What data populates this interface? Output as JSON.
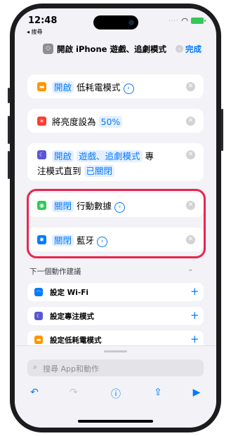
{
  "status": {
    "time": "12:48",
    "back_app": "◂ 搜尋"
  },
  "nav": {
    "title": "開啟 iPhone 遊戲、追劇模式",
    "done": "完成"
  },
  "actions": [
    {
      "verb": "開啟",
      "label": "低耗電模式"
    },
    {
      "text": "將亮度設為",
      "value": "50%"
    },
    {
      "verb": "開啟",
      "mode": "遊戲、追劇模式",
      "text1": "專",
      "text2": "注模式直到",
      "until": "已關閉"
    },
    {
      "verb": "關閉",
      "label": "行動數據"
    },
    {
      "verb": "關閉",
      "label": "藍牙"
    }
  ],
  "suggestions": {
    "header": "下一個動作建議",
    "items": [
      {
        "label": "設定 Wi-Fi"
      },
      {
        "label": "設定專注模式"
      },
      {
        "label": "設定低耗電模式"
      }
    ]
  },
  "search": {
    "placeholder": "搜尋 App和動作"
  },
  "colors": {
    "accent": "#007aff",
    "highlight": "#e8264c",
    "low_power": "#ff9500",
    "brightness": "#ff3b30",
    "focus": "#5856d6",
    "cellular": "#34c759",
    "bluetooth": "#007aff",
    "wifi": "#007aff"
  },
  "icons": [
    "shortcuts-icon",
    "battery-icon",
    "brightness-icon",
    "moon-icon",
    "cellular-icon",
    "bluetooth-icon",
    "wifi-icon",
    "undo-icon",
    "redo-icon",
    "info-icon",
    "share-icon",
    "play-icon",
    "search-icon"
  ]
}
